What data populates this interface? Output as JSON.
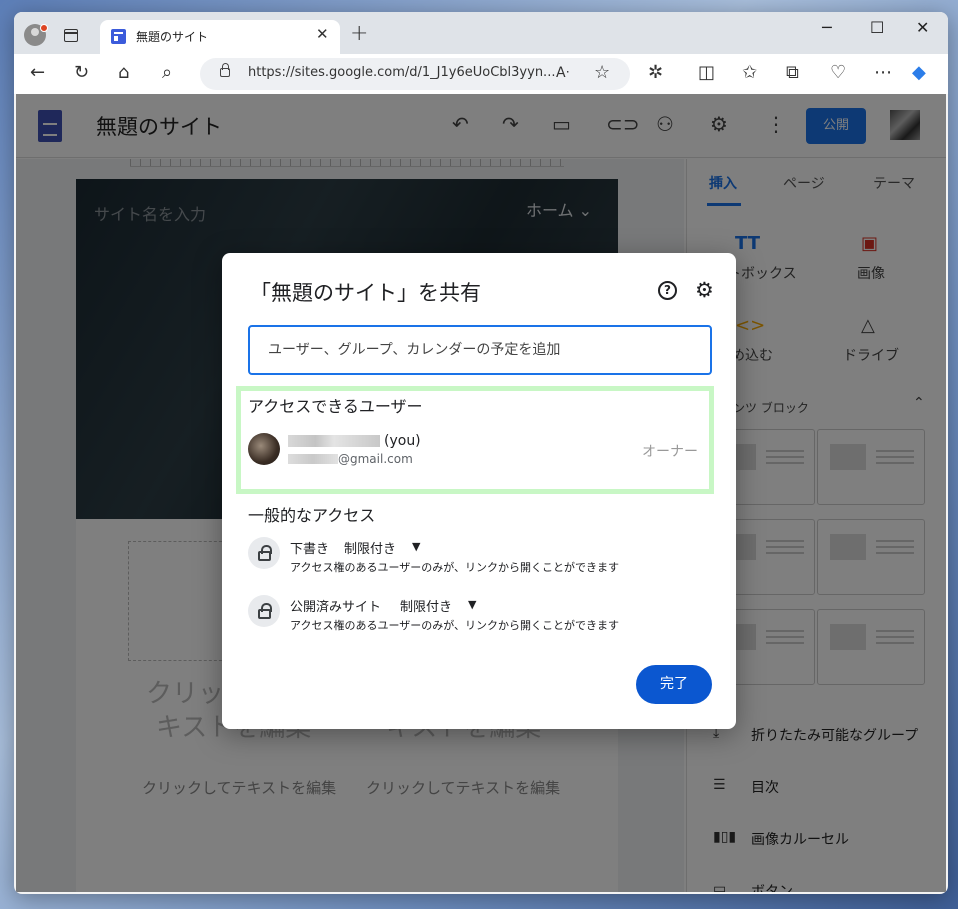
{
  "browser": {
    "tab_title": "無題のサイト",
    "url": "https://sites.google.com/d/1_J1y6eUoCbl3yyn..."
  },
  "app": {
    "site_title": "無題のサイト",
    "publish_label": "公開",
    "hero_site_name_placeholder": "サイト名を入力",
    "hero_nav_home": "ホーム",
    "placeholder_big_left_1": "クリッ",
    "placeholder_big_left_2": "キストを編集",
    "placeholder_big_right": "キストを編集",
    "placeholder_small_left": "クリックしてテキストを編集",
    "placeholder_small_right": "クリックしてテキストを編集"
  },
  "panel": {
    "tabs": [
      "挿入",
      "ページ",
      "テーマ"
    ],
    "items": {
      "textbox": "トボックス",
      "image": "画像",
      "embed": "め込む",
      "drive": "ドライブ",
      "content_block": "ンツ ブロック",
      "collapsible_group": "折りたたみ可能なグループ",
      "toc": "目次",
      "carousel": "画像カルーセル",
      "button": "ボタン"
    }
  },
  "dialog": {
    "title": "「無題のサイト」を共有",
    "input_placeholder": "ユーザー、グループ、カレンダーの予定を追加",
    "access_users_title": "アクセスできるユーザー",
    "user_you": "(you)",
    "user_email_domain": "@gmail.com",
    "user_role": "オーナー",
    "general_access_title": "一般的なアクセス",
    "draft_label": "下書き",
    "draft_value": "制限付き",
    "draft_desc": "アクセス権のあるユーザーのみが、リンクから開くことができます",
    "published_label": "公開済みサイト",
    "published_value": "制限付き",
    "published_desc": "アクセス権のあるユーザーのみが、リンクから開くことができます",
    "done_label": "完了"
  }
}
